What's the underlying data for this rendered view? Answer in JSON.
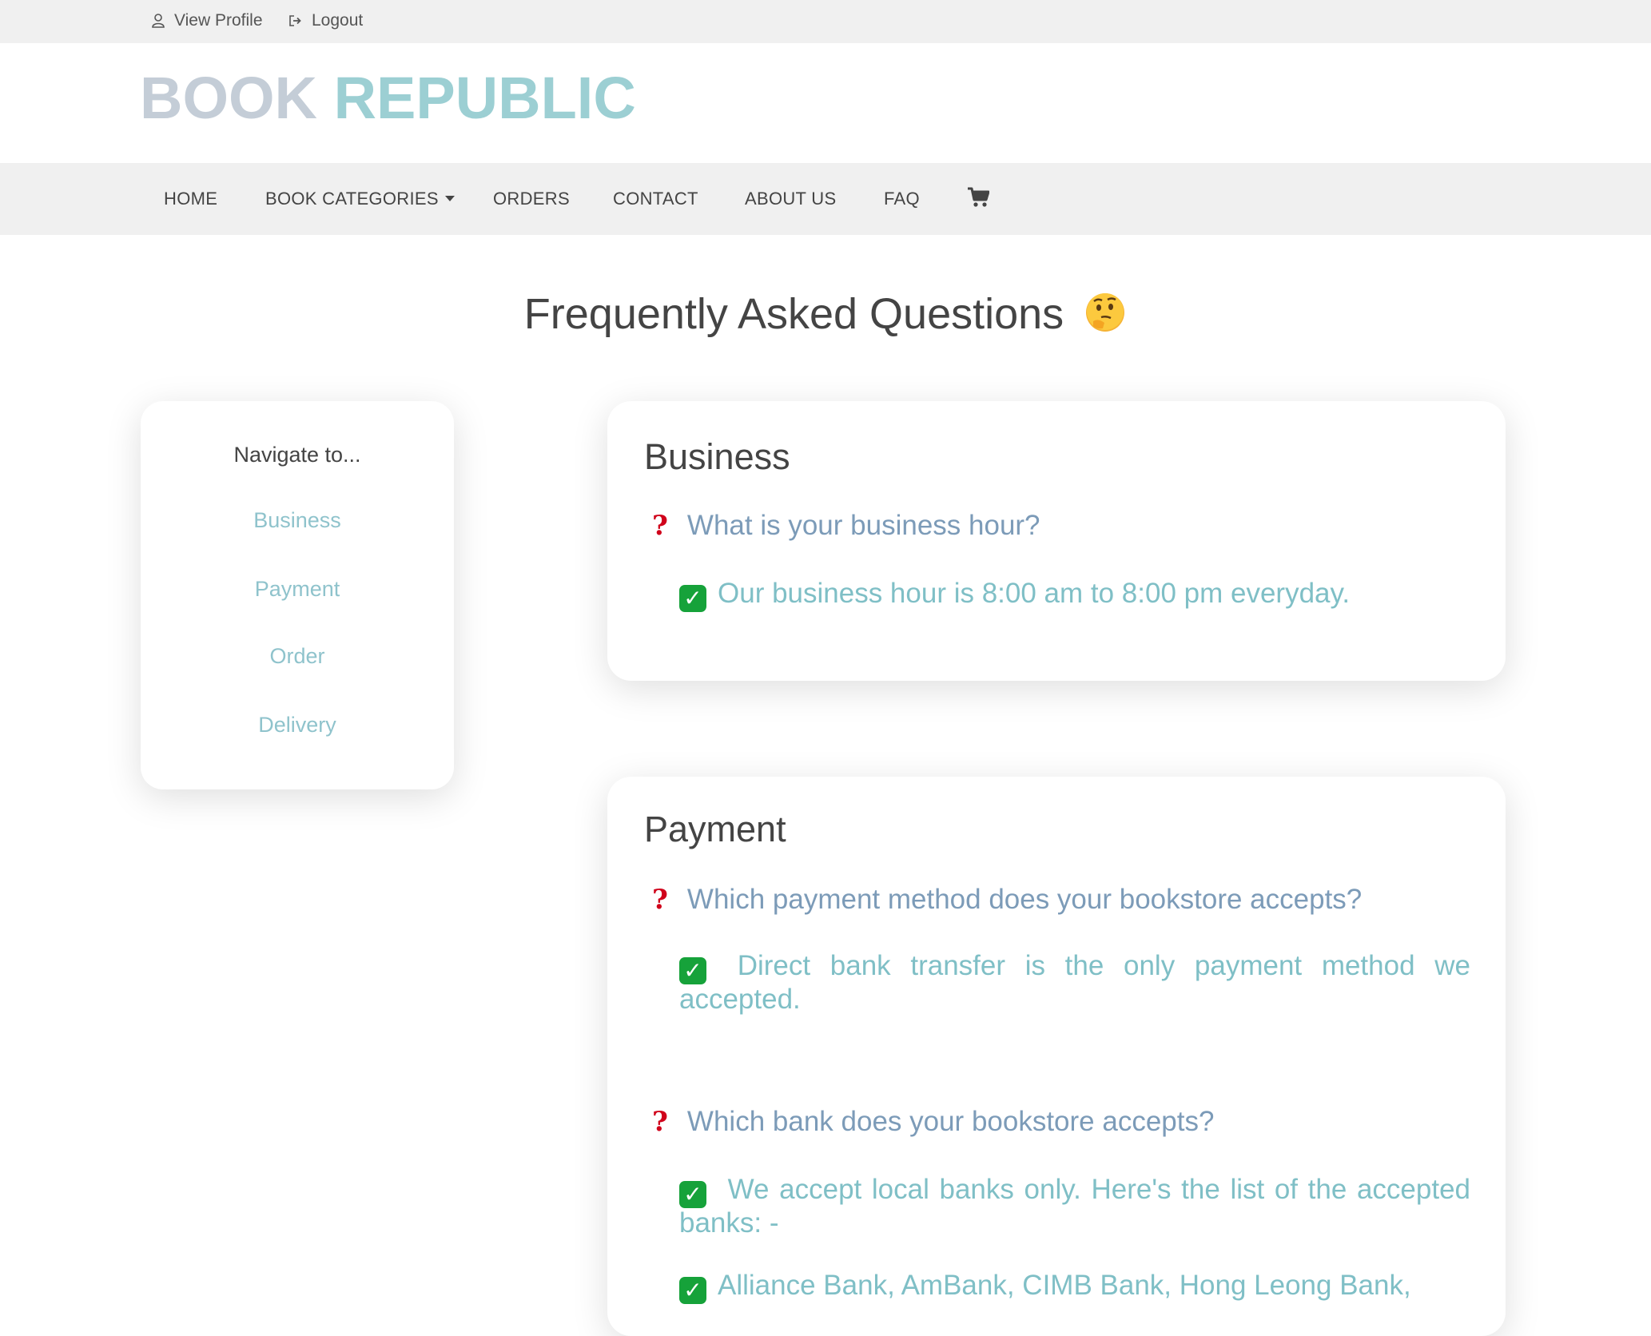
{
  "topbar": {
    "view_profile": "View Profile",
    "logout": "Logout"
  },
  "brand": {
    "part1": "BOOK",
    "part2": "REPUBLIC"
  },
  "nav": {
    "home": "HOME",
    "categories": "BOOK CATEGORIES",
    "orders": "ORDERS",
    "contact": "CONTACT",
    "about": "ABOUT US",
    "faq": "FAQ",
    "cart_icon": "shopping-cart-icon"
  },
  "page": {
    "title": "Frequently Asked Questions",
    "title_icon": "thinking-face-emoji"
  },
  "sidebar": {
    "heading": "Navigate to...",
    "items": [
      "Business",
      "Payment",
      "Order",
      "Delivery"
    ]
  },
  "sections": {
    "business": {
      "title": "Business",
      "q1": "What is your business hour?",
      "a1": "Our business hour is 8:00 am to 8:00 pm everyday."
    },
    "payment": {
      "title": "Payment",
      "q1": "Which payment method does your bookstore accepts?",
      "a1": "Direct bank transfer is the only payment method we accepted.",
      "q2": "Which bank does your bookstore accepts?",
      "a2": "We accept local banks only. Here's the list of the accepted banks: -",
      "a3": "Alliance Bank, AmBank, CIMB Bank, Hong Leong Bank,"
    }
  },
  "colors": {
    "brand_grey": "#c4cdd7",
    "brand_teal": "#9ccfd3",
    "question": "#7c9bb8",
    "answer": "#7fbfc6",
    "qmark": "#d0021b",
    "check": "#16a23a"
  }
}
